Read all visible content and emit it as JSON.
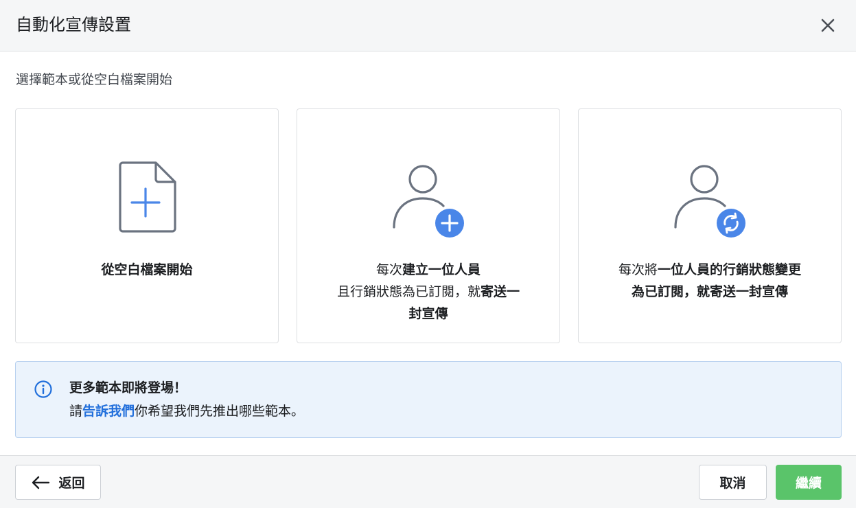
{
  "dialog": {
    "title": "自動化宣傳設置"
  },
  "subtitle": "選擇範本或從空白檔案開始",
  "cards": [
    {
      "icon": "blank-document-plus-icon",
      "text": "從空白檔案開始"
    },
    {
      "icon": "person-add-icon",
      "line1_prefix": "每次",
      "line1_bold": "建立一位人員",
      "line2_light": "且行銷狀態為已訂閱，就",
      "line2_bold": "寄送一",
      "line3_bold": "封宣傳"
    },
    {
      "icon": "person-sync-icon",
      "line1_prefix": "每次將",
      "line1_bold": "一位人員的行銷狀態變更",
      "line2_bold": "為已訂閱，就寄送一封宣傳"
    }
  ],
  "info": {
    "icon": "info-icon",
    "title": "更多範本即將登場！",
    "body_prefix": "請",
    "link": "告訴我們",
    "body_suffix": "你希望我們先推出哪些範本。"
  },
  "footer": {
    "back_label": "返回",
    "cancel_label": "取消",
    "continue_label": "繼續"
  },
  "colors": {
    "accent_blue": "#4a86e8",
    "link_blue": "#216fdb",
    "continue_green": "#5ac46a",
    "icon_gray": "#6b7380"
  }
}
